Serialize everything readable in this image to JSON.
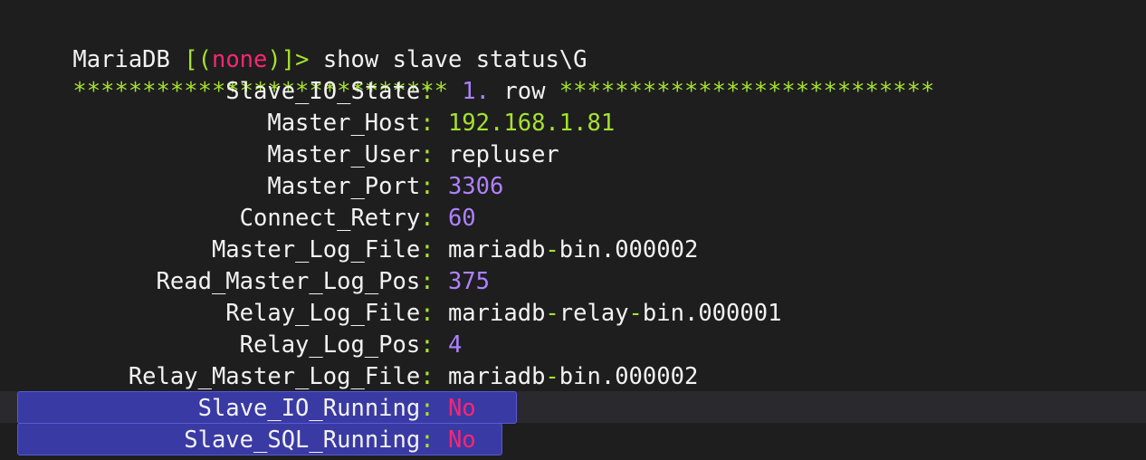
{
  "prompt": {
    "db": "MariaDB",
    "open_bracket": "[",
    "open_paren": "(",
    "schema": "none",
    "close_paren": ")",
    "close_bracket": "]>",
    "command": " show slave status\\G"
  },
  "row_header": {
    "stars_left": "*************************** ",
    "row_number": "1.",
    "row_word": " row ",
    "stars_right": "***************************"
  },
  "fields": [
    {
      "pad": "               ",
      "key": "Slave_IO_State",
      "value": ""
    },
    {
      "pad": "                  ",
      "key": "Master_Host",
      "value": "192.168.1.81"
    },
    {
      "pad": "                  ",
      "key": "Master_User",
      "value": "repluser"
    },
    {
      "pad": "                  ",
      "key": "Master_Port",
      "value": "3306"
    },
    {
      "pad": "                ",
      "key": "Connect_Retry",
      "value": "60"
    },
    {
      "pad": "              ",
      "key": "Master_Log_File",
      "value_a": "mariadb",
      "value_dash": "-",
      "value_b": "bin.000002"
    },
    {
      "pad": "          ",
      "key": "Read_Master_Log_Pos",
      "value": "375"
    },
    {
      "pad": "               ",
      "key": "Relay_Log_File",
      "value_a": "mariadb",
      "value_dash1": "-",
      "value_b": "relay",
      "value_dash2": "-",
      "value_c": "bin.000001"
    },
    {
      "pad": "                ",
      "key": "Relay_Log_Pos",
      "value": "4"
    },
    {
      "pad": "        ",
      "key": "Relay_Master_Log_File",
      "value_a": "mariadb",
      "value_dash": "-",
      "value_b": "bin.000002"
    },
    {
      "pad": "             ",
      "key": "Slave_IO_Running",
      "value": "No"
    },
    {
      "pad": "            ",
      "key": "Slave_SQL_Running",
      "value": "No"
    }
  ],
  "colon": ": ",
  "colors": {
    "background": "#1e1e1e",
    "text": "#f2f2f2",
    "green": "#a6e22e",
    "purple": "#ae81ff",
    "red": "#f92672",
    "selection": "#3a3aa4"
  }
}
